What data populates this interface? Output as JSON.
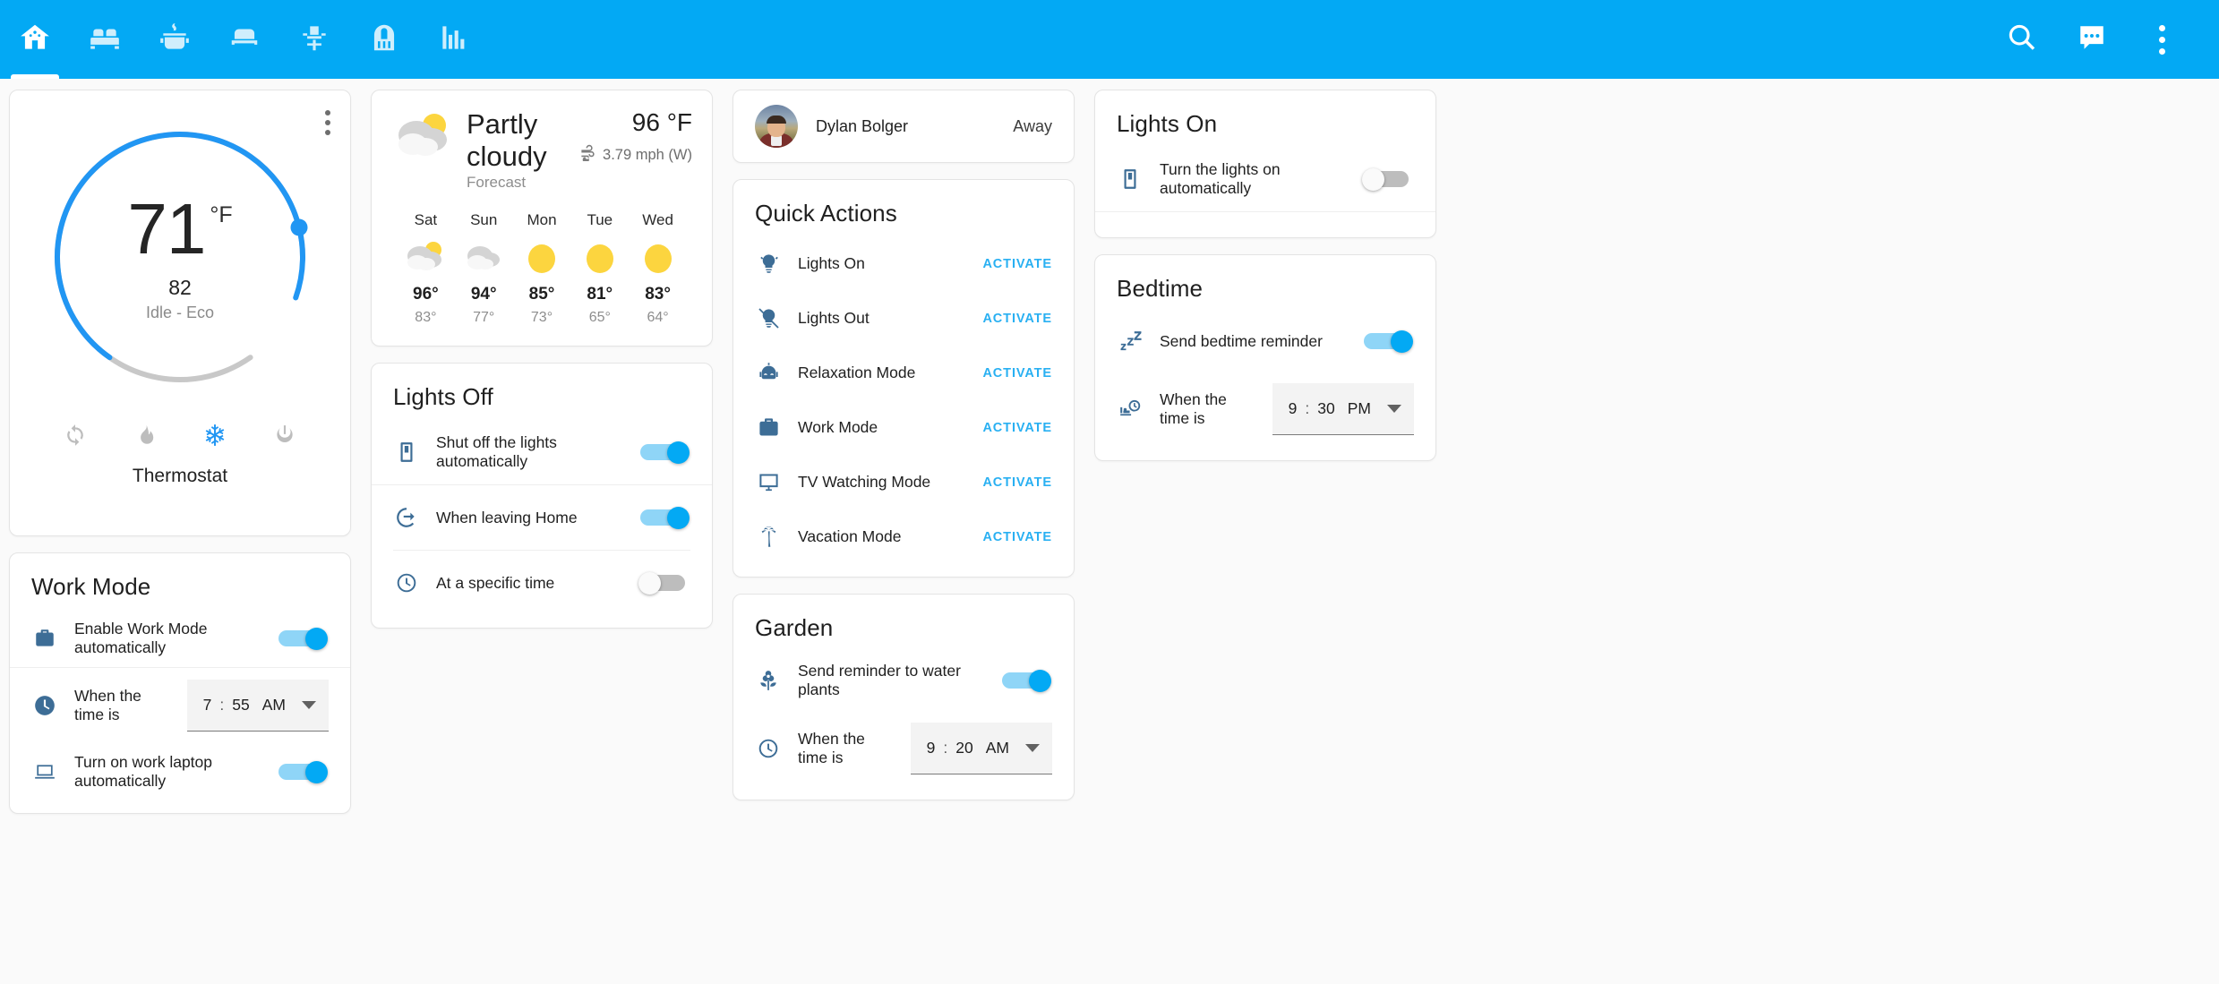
{
  "appbar": {
    "tabs": [
      {
        "name": "home",
        "icon": "smart-home-icon",
        "active": true
      },
      {
        "name": "living-room",
        "icon": "sofa-icon",
        "active": false
      },
      {
        "name": "kitchen",
        "icon": "cooking-pot-icon",
        "active": false
      },
      {
        "name": "bedroom",
        "icon": "bed-icon",
        "active": false
      },
      {
        "name": "office",
        "icon": "office-chair-icon",
        "active": false
      },
      {
        "name": "garage",
        "icon": "garage-door-icon",
        "active": false
      },
      {
        "name": "statistics",
        "icon": "bar-chart-icon",
        "active": false
      }
    ],
    "actions": [
      {
        "name": "search",
        "icon": "search-icon"
      },
      {
        "name": "messages",
        "icon": "chat-bubble-icon"
      },
      {
        "name": "overflow",
        "icon": "more-vertical-icon"
      }
    ],
    "accent_color": "#03A9F4"
  },
  "thermostat": {
    "temperature": "71",
    "unit": "°F",
    "target": "82",
    "state": "Idle - Eco",
    "device_name": "Thermostat",
    "modes": [
      {
        "name": "auto",
        "icon": "auto-refresh-icon",
        "active": false
      },
      {
        "name": "heat",
        "icon": "flame-icon",
        "active": false
      },
      {
        "name": "cool",
        "icon": "snowflake-icon",
        "active": true
      },
      {
        "name": "off",
        "icon": "power-icon",
        "active": false
      }
    ],
    "arc_color": "#2196F3",
    "arc_track_color": "#c8c8c8"
  },
  "work_mode": {
    "title": "Work Mode",
    "rows": [
      {
        "icon": "briefcase-icon",
        "label": "Enable Work Mode automatically",
        "toggle": true
      },
      {
        "icon": "clock-icon",
        "label": "When the time is",
        "time": {
          "hour": "7",
          "minute": "55",
          "meridiem": "AM"
        }
      },
      {
        "icon": "laptop-icon",
        "label": "Turn on work laptop automatically",
        "toggle": true
      }
    ]
  },
  "weather": {
    "condition": "Partly cloudy",
    "subtitle": "Forecast",
    "temperature": "96 °F",
    "wind": "3.79 mph (W)",
    "current_icon": "partly-cloudy-icon",
    "forecast": [
      {
        "day": "Sat",
        "icon": "partly-cloudy-icon",
        "high": "96°",
        "low": "83°"
      },
      {
        "day": "Sun",
        "icon": "cloudy-icon",
        "high": "94°",
        "low": "77°"
      },
      {
        "day": "Mon",
        "icon": "sunny-icon",
        "high": "85°",
        "low": "73°"
      },
      {
        "day": "Tue",
        "icon": "sunny-icon",
        "high": "81°",
        "low": "65°"
      },
      {
        "day": "Wed",
        "icon": "sunny-icon",
        "high": "83°",
        "low": "64°"
      }
    ]
  },
  "lights_off": {
    "title": "Lights Off",
    "rows": [
      {
        "icon": "light-switch-icon",
        "label": "Shut off the lights automatically",
        "toggle": true
      },
      {
        "icon": "exit-arrow-icon",
        "label": "When leaving Home",
        "toggle": true
      },
      {
        "icon": "clock-dashed-icon",
        "label": "At a specific time",
        "toggle": false
      }
    ]
  },
  "profile": {
    "name": "Dylan Bolger",
    "status": "Away",
    "avatar": "user-avatar"
  },
  "quick_actions": {
    "title": "Quick Actions",
    "activate_label": "ACTIVATE",
    "items": [
      {
        "icon": "light-bulb-on-icon",
        "label": "Lights On"
      },
      {
        "icon": "light-bulb-off-icon",
        "label": "Lights Out"
      },
      {
        "icon": "robot-icon",
        "label": "Relaxation Mode"
      },
      {
        "icon": "briefcase-icon",
        "label": "Work Mode"
      },
      {
        "icon": "tv-monitor-icon",
        "label": "TV Watching Mode"
      },
      {
        "icon": "palm-tree-icon",
        "label": "Vacation Mode"
      }
    ]
  },
  "garden": {
    "title": "Garden",
    "rows": [
      {
        "icon": "flower-icon",
        "label": "Send reminder to water plants",
        "toggle": true
      },
      {
        "icon": "clock-dashed-icon",
        "label": "When the time is",
        "time": {
          "hour": "9",
          "minute": "20",
          "meridiem": "AM"
        }
      }
    ]
  },
  "lights_on": {
    "title": "Lights On",
    "rows": [
      {
        "icon": "light-switch-icon",
        "label": "Turn the lights on automatically",
        "toggle": false
      }
    ]
  },
  "bedtime": {
    "title": "Bedtime",
    "rows": [
      {
        "icon": "zzz-icon",
        "label": "Send bedtime reminder",
        "toggle": true
      },
      {
        "icon": "bed-clock-icon",
        "label": "When the time is",
        "time": {
          "hour": "9",
          "minute": "30",
          "meridiem": "PM"
        }
      }
    ]
  }
}
